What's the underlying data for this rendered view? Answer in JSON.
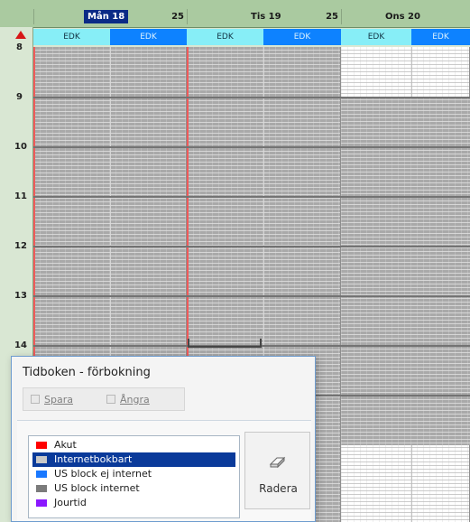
{
  "calendar": {
    "days": [
      {
        "label": "Mån 18",
        "count": "25",
        "resources": [
          "EDK",
          "EDK"
        ]
      },
      {
        "label": "Tis 19",
        "count": "25",
        "resources": [
          "EDK",
          "EDK"
        ]
      },
      {
        "label": "Ons 20",
        "count": "",
        "resources": [
          "EDK",
          "EDK"
        ]
      }
    ],
    "hours": [
      "8",
      "9",
      "10",
      "11",
      "12",
      "13",
      "14"
    ]
  },
  "dialog": {
    "title": "Tidboken - förbokning",
    "save_label": "Spara",
    "undo_label": "Ångra",
    "delete_label": "Radera",
    "legend": [
      {
        "label": "Akut",
        "color": "#ff0000",
        "selected": false
      },
      {
        "label": "Internetbokbart",
        "color": "#c8c8c8",
        "selected": true
      },
      {
        "label": "US block ej internet",
        "color": "#1978ff",
        "selected": false
      },
      {
        "label": "US block internet",
        "color": "#7b7b7b",
        "selected": false
      },
      {
        "label": "Jourtid",
        "color": "#8b18ff",
        "selected": false
      }
    ]
  },
  "colors": {
    "today_header": "#0b2b86",
    "resource_light": "#87eef7",
    "resource_dark": "#0d82ff",
    "booking_grey": "#a9a9a9",
    "free_white": "#ffffff"
  },
  "icons": {
    "scroll_up": "triangle-up-icon",
    "save": "save-icon",
    "undo": "undo-icon",
    "delete": "eraser-icon"
  }
}
